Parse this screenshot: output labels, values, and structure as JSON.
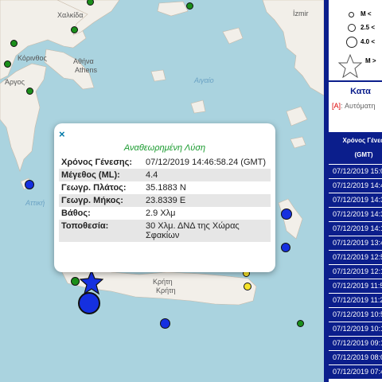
{
  "map": {
    "labels": {
      "chalkida": "Χαλκίδα",
      "athens_gr": "Αθήνα",
      "athens_en": "Athens",
      "izmir": "İzmir",
      "korinthos": "Κόρινθος",
      "argos": "Άργος",
      "aegean": "Αιγαίο",
      "attiki": "Αττική",
      "kriti_gr": "Κρήτη",
      "kriti_en": "Κρήτη"
    }
  },
  "popup": {
    "close": "×",
    "title": "Αναθεωρημένη Λύση",
    "rows": [
      {
        "label": "Χρόνος Γένεσης:",
        "value": "07/12/2019 14:46:58.24 (GMT)"
      },
      {
        "label": "Μέγεθος (ML):",
        "value": "4.4"
      },
      {
        "label": "Γεωγρ. Πλάτος:",
        "value": "35.1883 N"
      },
      {
        "label": "Γεωγρ. Μήκος:",
        "value": "23.8339 E"
      },
      {
        "label": "Βάθος:",
        "value": "2.9 Χλμ"
      },
      {
        "label": "Τοποθεσία:",
        "value": "30 Χλμ. ΔΝΔ της Χώρας Σφακίων"
      }
    ]
  },
  "legend": {
    "items": [
      "M <",
      "2.5 <",
      "4.0 <",
      "M >"
    ]
  },
  "catalog": {
    "title": "Κατα",
    "auto_tag": "[A]",
    "auto_text": ": Αυτόματη",
    "header_line1": "Χρόνος Γένεσ",
    "header_line2": "(GMT)",
    "rows": [
      "07/12/2019 15:0",
      "07/12/2019 14:4",
      "07/12/2019 14:3",
      "07/12/2019 14:3",
      "07/12/2019 14:1",
      "07/12/2019 13:4",
      "07/12/2019 12:5",
      "07/12/2019 12:1",
      "07/12/2019 11:5",
      "07/12/2019 11:2",
      "07/12/2019 10:5",
      "07/12/2019 10:1",
      "07/12/2019 09:1",
      "07/12/2019 08:0",
      "07/12/2019 07:4"
    ]
  }
}
